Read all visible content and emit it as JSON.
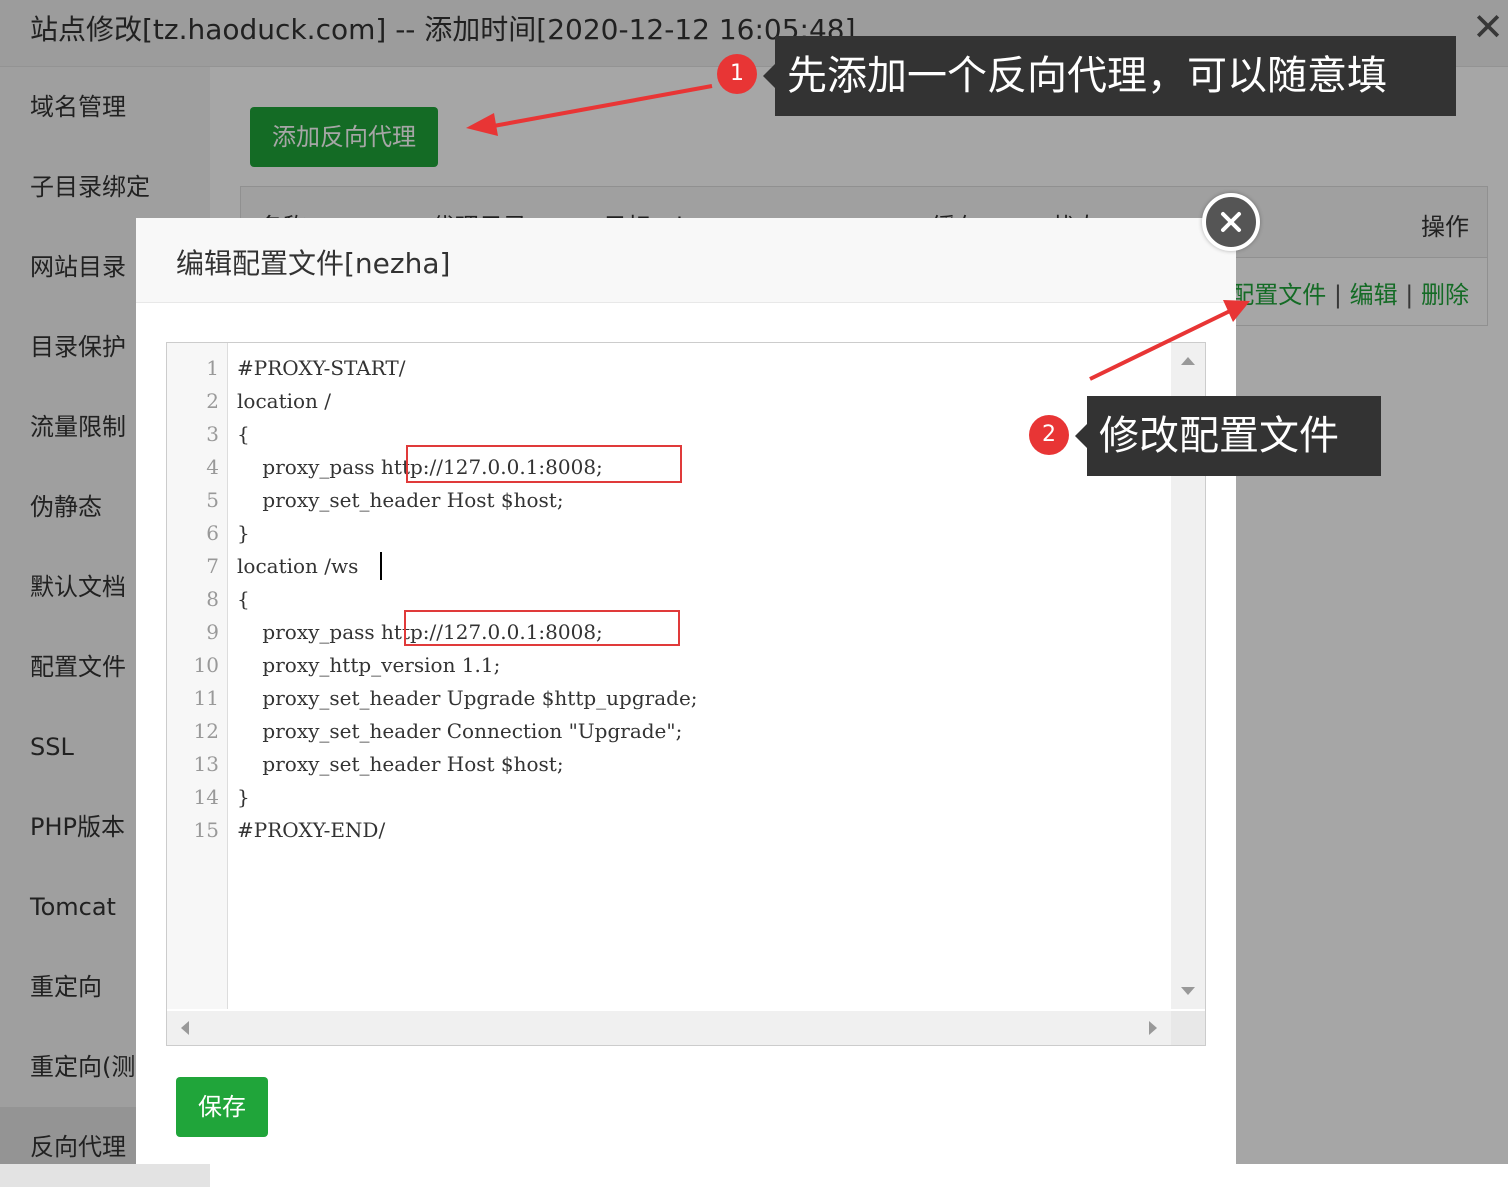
{
  "window": {
    "title": "站点修改[tz.haoduck.com] -- 添加时间[2020-12-12 16:05:48]",
    "close_glyph": "✕"
  },
  "sidebar": {
    "items": [
      {
        "label": "域名管理"
      },
      {
        "label": "子目录绑定"
      },
      {
        "label": "网站目录"
      },
      {
        "label": "目录保护"
      },
      {
        "label": "流量限制"
      },
      {
        "label": "伪静态"
      },
      {
        "label": "默认文档"
      },
      {
        "label": "配置文件"
      },
      {
        "label": "SSL"
      },
      {
        "label": "PHP版本"
      },
      {
        "label": "Tomcat"
      },
      {
        "label": "重定向"
      },
      {
        "label": "重定向(测试版)"
      },
      {
        "label": "反向代理"
      }
    ],
    "active": "反向代理"
  },
  "main": {
    "add_button": "添加反向代理",
    "table": {
      "columns": [
        "名称",
        "代理目录",
        "目标url",
        "缓存",
        "状态",
        "操作"
      ],
      "row_actions": {
        "config": "配置文件",
        "edit": "编辑",
        "delete": "删除",
        "separator": "|"
      }
    }
  },
  "modal": {
    "title": "编辑配置文件[nezha]",
    "save_button": "保存",
    "editor": {
      "lines": [
        "#PROXY-START/",
        "location /",
        "{",
        "    proxy_pass http://127.0.0.1:8008;",
        "    proxy_set_header Host $host;",
        "}",
        "location /ws",
        "{",
        "    proxy_pass http://127.0.0.1:8008;",
        "    proxy_http_version 1.1;",
        "    proxy_set_header Upgrade $http_upgrade;",
        "    proxy_set_header Connection \"Upgrade\";",
        "    proxy_set_header Host $host;",
        "}",
        "#PROXY-END/"
      ],
      "line_numbers": [
        "1",
        "2",
        "3",
        "4",
        "5",
        "6",
        "7",
        "8",
        "9",
        "10",
        "11",
        "12",
        "13",
        "14",
        "15"
      ]
    }
  },
  "annotations": [
    {
      "number": "1",
      "text": "先添加一个反向代理，可以随意填"
    },
    {
      "number": "2",
      "text": "修改配置文件"
    }
  ],
  "colors": {
    "accent_green": "#20a53a",
    "annotation_red": "#e83535",
    "callout_bg": "#333333"
  }
}
